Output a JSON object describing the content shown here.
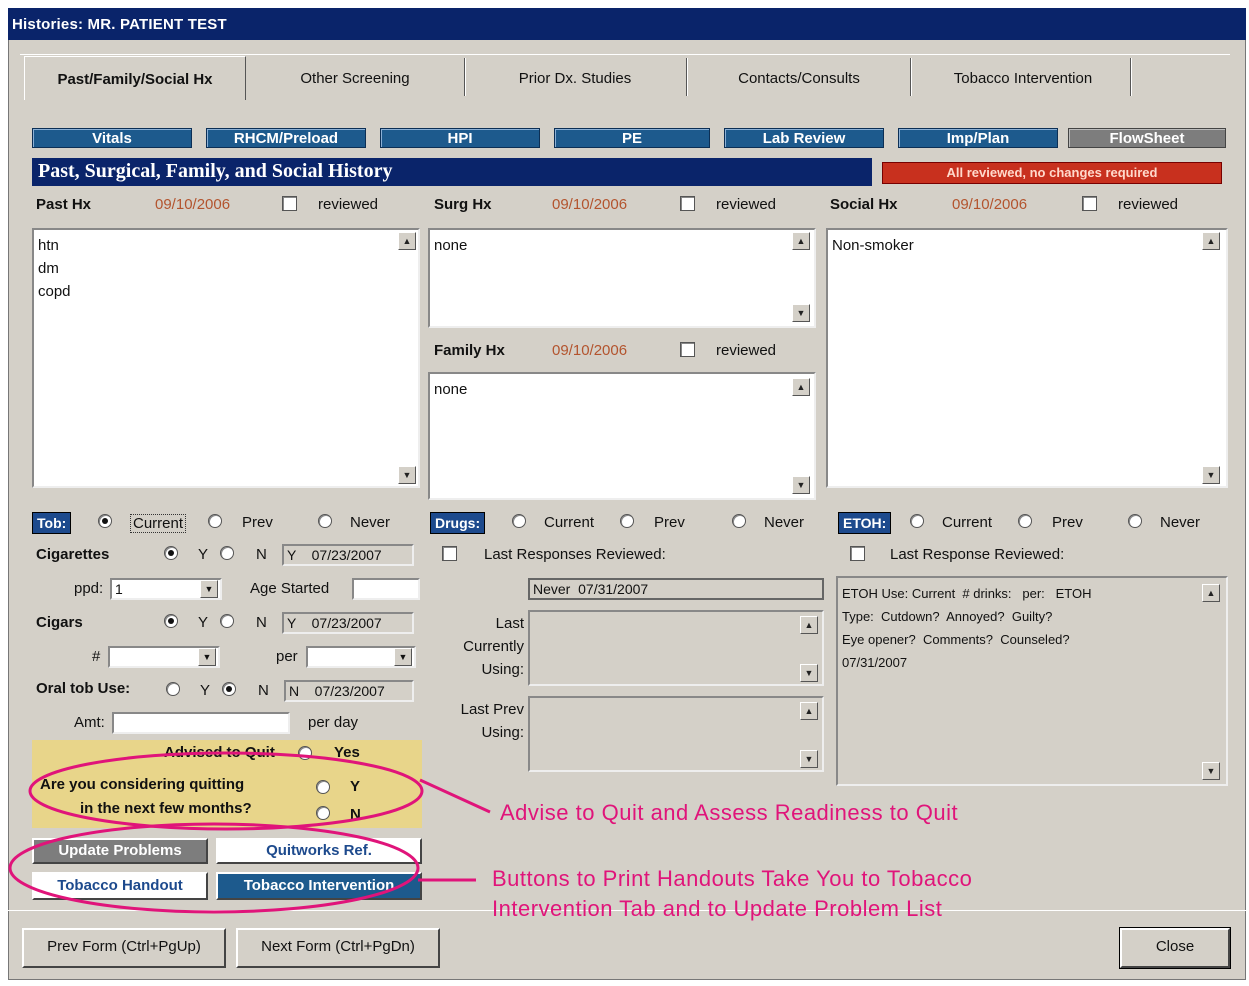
{
  "window_title": "Histories: MR. PATIENT TEST",
  "tabs": [
    "Past/Family/Social Hx",
    "Other Screening",
    "Prior Dx. Studies",
    "Contacts/Consults",
    "Tobacco Intervention"
  ],
  "nav_buttons": [
    "Vitals",
    "RHCM/Preload",
    "HPI",
    "PE",
    "Lab Review",
    "Imp/Plan",
    "FlowSheet"
  ],
  "section_title": "Past, Surgical, Family, and Social History",
  "status_badge": "All reviewed, no changes required",
  "past_hx": {
    "label": "Past Hx",
    "date": "09/10/2006",
    "reviewed_label": "reviewed",
    "text": "htn\ndm\ncopd"
  },
  "surg_hx": {
    "label": "Surg Hx",
    "date": "09/10/2006",
    "reviewed_label": "reviewed",
    "text": "none"
  },
  "social_hx": {
    "label": "Social Hx",
    "date": "09/10/2006",
    "reviewed_label": "reviewed",
    "text": "Non-smoker"
  },
  "family_hx": {
    "label": "Family Hx",
    "date": "09/10/2006",
    "reviewed_label": "reviewed",
    "text": "none"
  },
  "tob": {
    "label": "Tob:",
    "options": [
      "Current",
      "Prev",
      "Never"
    ],
    "cigarettes": {
      "label": "Cigarettes",
      "y": "Y",
      "n": "N",
      "value": "Y    07/23/2007"
    },
    "ppd_label": "ppd:",
    "ppd_value": "1",
    "age_started_label": "Age Started",
    "cigars": {
      "label": "Cigars",
      "y": "Y",
      "n": "N",
      "value": "Y    07/23/2007"
    },
    "num_label": "#",
    "per_label": "per",
    "oral": {
      "label": "Oral tob Use:",
      "y": "Y",
      "n": "N",
      "value": "N    07/23/2007"
    },
    "amt_label": "Amt:",
    "per_day_label": "per day"
  },
  "drugs": {
    "label": "Drugs:",
    "options": [
      "Current",
      "Prev",
      "Never"
    ],
    "last_reviewed_label": "Last Responses Reviewed:",
    "never_value": "Never  07/31/2007",
    "last_currently_label": "Last\nCurrently\nUsing:",
    "last_prev_label": "Last Prev\nUsing:"
  },
  "etoh": {
    "label": "ETOH:",
    "options": [
      "Current",
      "Prev",
      "Never"
    ],
    "last_reviewed_label": "Last Response Reviewed:",
    "text": "ETOH Use: Current  # drinks:   per:   ETOH\nType:  Cutdown?  Annoyed?  Guilty?\nEye opener?  Comments?  Counseled?\n07/31/2007"
  },
  "quit": {
    "advised_label": "Advised to Quit",
    "advised_yes": "Yes",
    "considering_label1": "Are you considering quitting",
    "considering_label2": "in the next few months?",
    "y": "Y",
    "n": "N"
  },
  "buttons": {
    "update_problems": "Update Problems",
    "quitworks": "Quitworks Ref.",
    "tobacco_handout": "Tobacco Handout",
    "tobacco_intervention": "Tobacco Intervention",
    "prev_form": "Prev Form (Ctrl+PgUp)",
    "next_form": "Next Form (Ctrl+PgDn)",
    "close": "Close"
  },
  "annotations": {
    "advise": "Advise to Quit and Assess Readiness to Quit",
    "buttons_line1": "Buttons to Print Handouts Take You to Tobacco",
    "buttons_line2": "Intervention Tab and to Update Problem List"
  },
  "colors": {
    "titlebar": "#0a246a",
    "nav": "#1d5a8d",
    "badge": "#c8301e",
    "date": "#b3542e",
    "annotation": "#e0147a",
    "highlight": "#e8d58a"
  }
}
